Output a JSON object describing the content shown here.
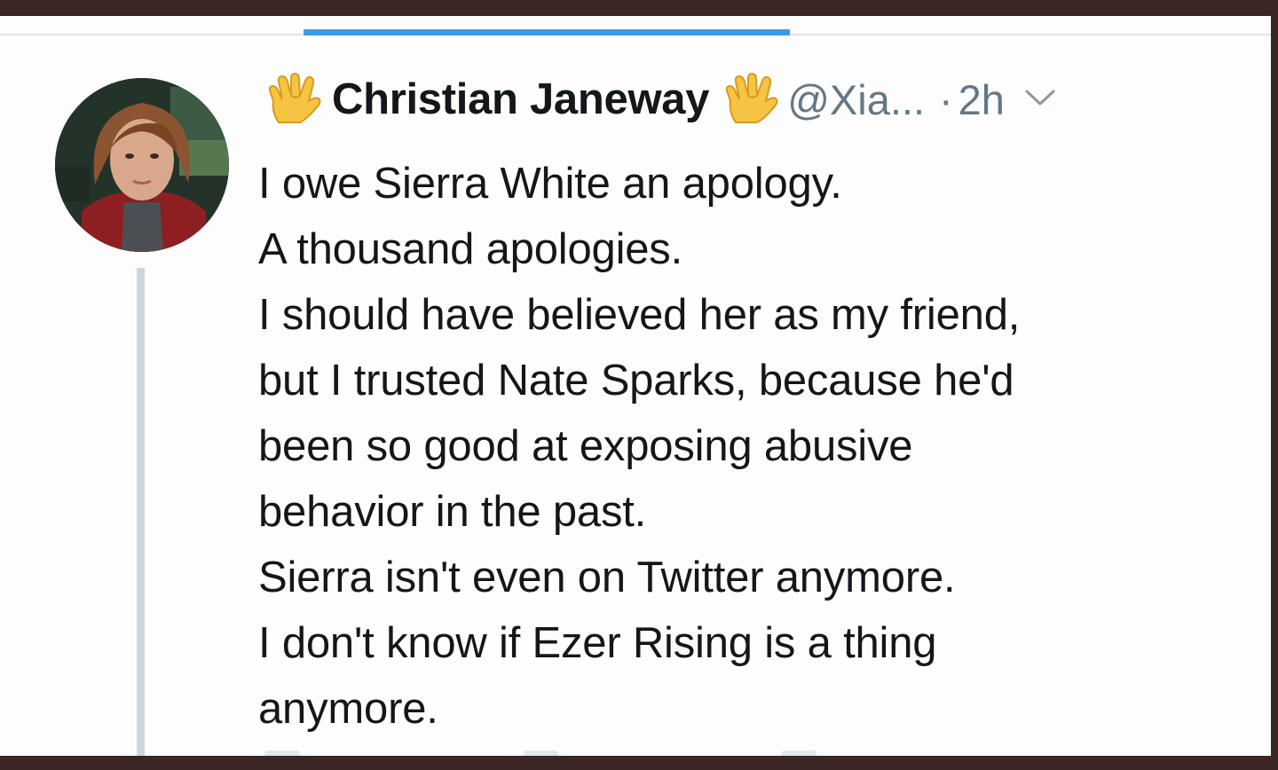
{
  "tweet": {
    "display_name": "Christian Janeway",
    "handle": "@Xia...",
    "separator": "·",
    "time": "2h",
    "lines": [
      "I owe Sierra White an apology.",
      "A thousand apologies.",
      "I should have believed her as my friend,",
      "but I trusted Nate Sparks, because he'd",
      "been so good at exposing abusive",
      "behavior in the past.",
      "Sierra isn't even on Twitter anymore.",
      "I don't know if Ezer Rising is a thing",
      "anymore."
    ]
  },
  "icons": {
    "name_prefix_emoji": "vulcan-salute-emoji",
    "name_suffix_emoji": "vulcan-salute-emoji",
    "menu": "chevron-down-icon"
  },
  "colors": {
    "tab_indicator": "#3b9be6",
    "text_primary": "#14171a",
    "text_secondary": "#657786",
    "thread_line": "#ccd6dd",
    "frame": "#3a2622"
  }
}
